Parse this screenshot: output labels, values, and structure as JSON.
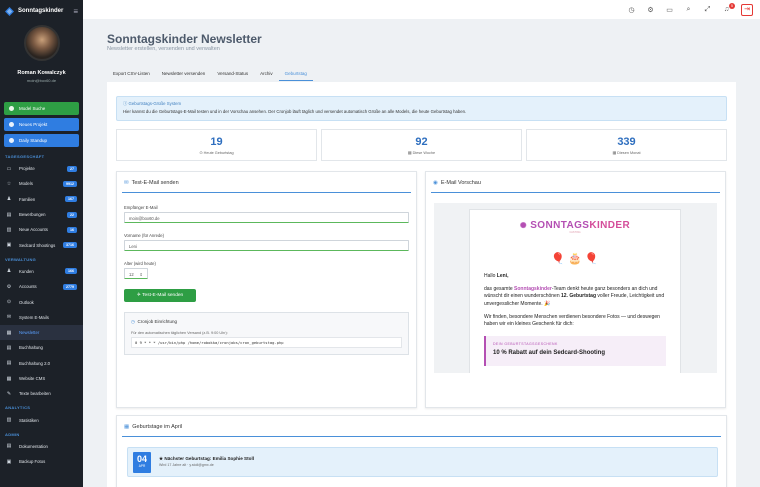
{
  "app": {
    "name": "Sonntagskinder"
  },
  "user": {
    "name": "Roman Kowalczyk",
    "email": "moin@box60.de"
  },
  "quick": [
    {
      "label": "Model Suche",
      "color": "#2e9e44"
    },
    {
      "label": "Neues Projekt",
      "color": "#2f7de1"
    },
    {
      "label": "Daily Standup",
      "color": "#2f7de1"
    }
  ],
  "sections": {
    "business": "TAGESGESCHÄFT",
    "admin_v": "VERWALTUNG",
    "analytics": "ANALYTICS",
    "admin": "ADMIN"
  },
  "nav_business": [
    {
      "label": "Projekte",
      "badge": "27",
      "icon": "▭"
    },
    {
      "label": "Models",
      "badge": "9912",
      "icon": "☆"
    },
    {
      "label": "Familien",
      "badge": "167",
      "icon": "♟"
    },
    {
      "label": "Bewerbungen",
      "badge": "22",
      "icon": "▤"
    },
    {
      "label": "Neue Accounts",
      "badge": "16",
      "icon": "▥"
    },
    {
      "label": "Sedcard Shootings",
      "badge": "3716",
      "icon": "▣"
    }
  ],
  "nav_admin_v": [
    {
      "label": "Kunden",
      "badge": "166",
      "icon": "♟"
    },
    {
      "label": "Accounts",
      "badge": "2779",
      "icon": "⚙"
    },
    {
      "label": "Outlook",
      "badge": "",
      "icon": "⊙"
    },
    {
      "label": "System E-Mails",
      "badge": "",
      "icon": "✉"
    },
    {
      "label": "Newsletter",
      "badge": "",
      "icon": "▦",
      "active": true
    },
    {
      "label": "Buchhaltung",
      "badge": "",
      "icon": "▤"
    },
    {
      "label": "Buchhaltung 2.0",
      "badge": "",
      "icon": "▤"
    },
    {
      "label": "Website CMS",
      "badge": "",
      "icon": "▦"
    },
    {
      "label": "Texte bearbeiten",
      "badge": "",
      "icon": "✎"
    }
  ],
  "nav_analytics": [
    {
      "label": "Statistiken",
      "badge": "",
      "icon": "▥"
    }
  ],
  "nav_admin": [
    {
      "label": "Dokumentation",
      "badge": "",
      "icon": "▤"
    },
    {
      "label": "Backup Fotos",
      "badge": "",
      "icon": "▣"
    }
  ],
  "topbar": {
    "notif_count": "5"
  },
  "page": {
    "title": "Sonntagskinder Newsletter",
    "subtitle": "Newsletter erstellen, versenden und verwalten"
  },
  "tabs": [
    "Export CSV-Listen",
    "Newsletter versenden",
    "Versand-Status",
    "Archiv",
    "Geburtstag"
  ],
  "info": {
    "title": "Geburtstags-Grüße System",
    "text": "Hier kannst du die Geburtstags-E-Mail testen und in der Vorschau ansehen. Der Cronjob läuft täglich und versendet automatisch Grüße an alle Models, die heute Geburtstag haben."
  },
  "stats": [
    {
      "value": "19",
      "label": "Heute Geburtstag"
    },
    {
      "value": "92",
      "label": "Diese Woche"
    },
    {
      "value": "339",
      "label": "Diesen Monat"
    }
  ],
  "test": {
    "title": "Test-E-Mail senden",
    "email_label": "Empfänger E-Mail",
    "email_value": "moin@box60.de",
    "name_label": "Vorname (für Anrede)",
    "name_value": "Leni",
    "age_label": "Alter (wird heute)",
    "age_value": "12",
    "send": "Test-E-Mail senden",
    "cron_title": "Cronjob Einrichtung",
    "cron_desc": "Für den automatischen täglichen Versand (z.B. 9:00 Uhr):",
    "cron_code": "0 9 * * * /usr/bin/php /home/robokka/cronjobs/cron_geburtstag.php"
  },
  "preview": {
    "title": "E-Mail Vorschau",
    "brand_a": "SONNTAGS",
    "brand_b": "KINDER",
    "brand_sub": "CASTING",
    "hello": "Hallo ",
    "hello_name": "Leni,",
    "p1a": "das gesamte ",
    "p1b": "Sonntagskinder",
    "p1c": "-Team denkt heute ganz besonders an dich und wünscht dir einen wunderschönen ",
    "p1d": "12. Geburtstag",
    "p1e": " voller Freude, Leichtigkeit und unvergesslicher Momente. 🎉",
    "p2": "Wir finden, besondere Menschen verdienen besondere Fotos — und deswegen haben wir ein kleines Geschenk für dich:",
    "gift_title": "DEIN GEBURTSTAGSGESCHENK",
    "gift_value": "10 % Rabatt auf dein Sedcard-Shooting"
  },
  "april": {
    "title": "Geburtstage im April",
    "day": "04",
    "month": "APR",
    "next": "Nächster Geburtstag: Emilia Sophie Stoll",
    "detail": "Wird 17 Jahre alt · y.stoll@gmx.de"
  }
}
